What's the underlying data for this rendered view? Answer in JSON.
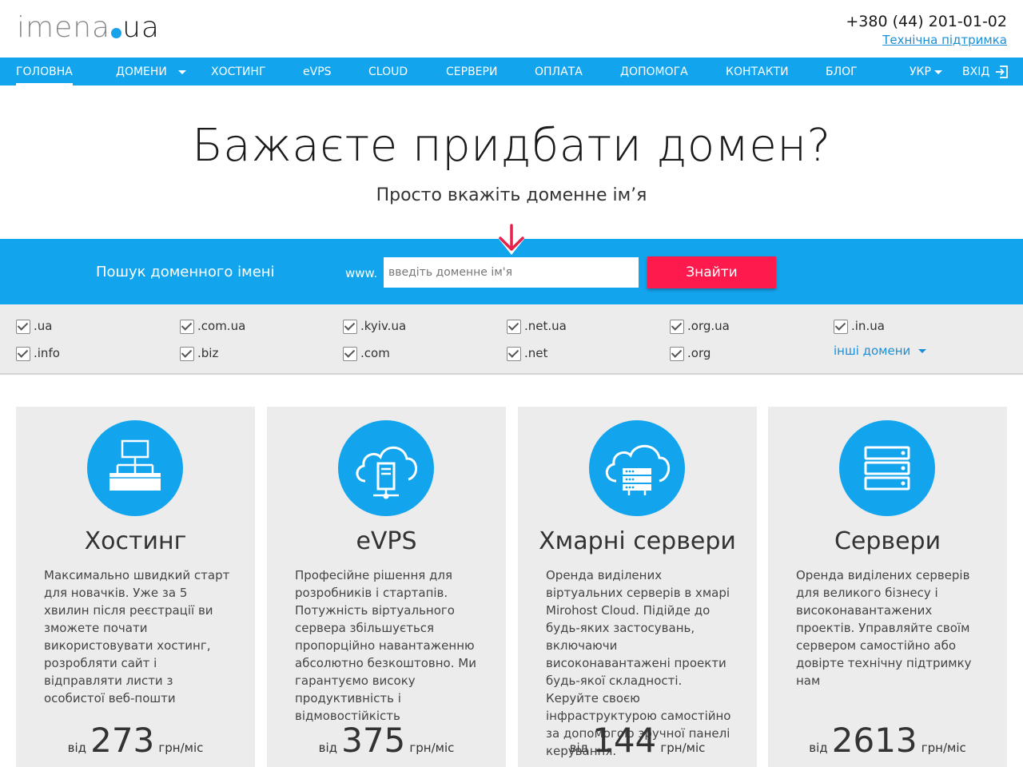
{
  "header": {
    "logo_name": "imena",
    "logo_tld": "ua",
    "phone": "+380 (44) 201-01-02",
    "support_link": "Технічна підтримка"
  },
  "nav": {
    "home": "ГОЛОВНА",
    "domains": "ДОМЕНИ",
    "hosting": "ХОСТИНГ",
    "evps": "eVPS",
    "cloud": "CLOUD",
    "servers": "СЕРВЕРИ",
    "payment": "ОПЛАТА",
    "help": "ДОПОМОГА",
    "contacts": "КОНТАКТИ",
    "blog": "БЛОГ",
    "language": "УКР",
    "login": "ВХІД"
  },
  "hero": {
    "title": "Бажаєте придбати домен?",
    "subtitle": "Просто вкажіть доменне ім’я"
  },
  "search": {
    "label": "Пошук доменного імені",
    "prefix": "www.",
    "placeholder": "введіть доменне ім'я",
    "value": "",
    "button": "Знайти"
  },
  "domains": {
    "items": [
      {
        "label": ".ua",
        "checked": true
      },
      {
        "label": ".com.ua",
        "checked": true
      },
      {
        "label": ".kyiv.ua",
        "checked": true
      },
      {
        "label": ".net.ua",
        "checked": true
      },
      {
        "label": ".org.ua",
        "checked": true
      },
      {
        "label": ".in.ua",
        "checked": true
      },
      {
        "label": ".info",
        "checked": true
      },
      {
        "label": ".biz",
        "checked": true
      },
      {
        "label": ".com",
        "checked": true
      },
      {
        "label": ".net",
        "checked": true
      },
      {
        "label": ".org",
        "checked": true
      }
    ],
    "more": "інші домени"
  },
  "cards": [
    {
      "icon": "hosting-network-icon",
      "title": "Хостинг",
      "desc": "Максимально швидкий старт для новачків. Уже за 5 хвилин після реєстрації ви зможете почати використовувати хостинг, розробляти сайт і відправляти листи з особистої веб-пошти",
      "from": "від",
      "price": "273",
      "unit": "грн/міс"
    },
    {
      "icon": "evps-cloud-server-icon",
      "title": "eVPS",
      "desc": "Професійне рішення для розробників і стартапів. Потужність віртуального сервера збільшується пропорційно навантаженню абсолютно безкоштовно. Ми гарантуємо високу продуктивність і відмовостійкість",
      "from": "від",
      "price": "375",
      "unit": "грн/міс"
    },
    {
      "icon": "cloud-server-icon",
      "title": "Хмарні сервери",
      "desc": "Оренда виділених віртуальних серверів в хмарі Mirohost Cloud. Підійде до будь-яких застосувань, включаючи високонавантажені проекти будь-якої складності. Керуйте своєю інфраструктурою самостійно за допомогою зручної панелі керування.",
      "from": "від",
      "price": "144",
      "unit": "грн/міс"
    },
    {
      "icon": "server-rack-icon",
      "title": "Сервери",
      "desc": "Оренда виділених серверів для великого бізнесу і високонавантажених проектів. Управляйте своїм сервером самостійно або довірте технічну підтримку нам",
      "from": "від",
      "price": "2613",
      "unit": "грн/міс"
    }
  ],
  "colors": {
    "brand_blue": "#12a5ed",
    "cta_red": "#ff1a4d",
    "link_blue": "#1a8fd8"
  }
}
